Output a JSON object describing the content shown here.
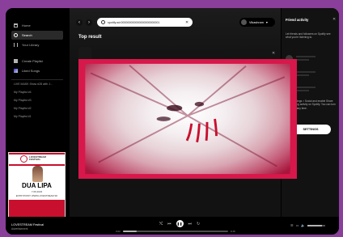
{
  "sidebar": {
    "nav": [
      {
        "label": "Home",
        "icon": "home-icon"
      },
      {
        "label": "Search",
        "icon": "search-icon"
      },
      {
        "label": "Your Library",
        "icon": "library-icon"
      }
    ],
    "create_playlist": "Create Playlist",
    "liked_songs": "Liked Songs",
    "playlists": [
      "LIVE MASK Show #28 with J...",
      "My Playlist #4",
      "My Playlist #3",
      "My Playlist #2",
      "My Playlist #1"
    ],
    "cover": {
      "brand_line1": "LOVESTREAM",
      "brand_line2": "FESTIVAL",
      "artist": "DUA LIPA",
      "date": "7.06.2023",
      "tickets": "ENTRYPOINT: WWW.LOVESTREAM.SK"
    }
  },
  "topbar": {
    "back": "‹",
    "forward": "›",
    "search_value": "spotify:ad:000000000000000000000001",
    "clear": "✕",
    "user_name": "Vikashram",
    "user_caret": "▾"
  },
  "main": {
    "heading": "Top result",
    "close": "✕"
  },
  "activity": {
    "title": "Friend activity",
    "close": "✕",
    "intro": "Let friends and followers on Spotify see what you're listening to.",
    "settings_text": "Go to Settings > Social and enable Share my listening activity on Spotify. You can turn this off at any time.",
    "settings_button": "SETTINGS"
  },
  "player": {
    "title": "LOVESTREAM Festival",
    "artist": "Advertisement",
    "shuffle": "⤭",
    "prev": "⏮",
    "play": "❚❚",
    "next": "⏭",
    "repeat": "↻",
    "elapsed": "0:02",
    "duration": "0:15",
    "progress": 0.13,
    "volume": 0.8,
    "right_icons": [
      "☰",
      "▭",
      "🔈"
    ]
  },
  "colors": {
    "background": "#8a3f9a",
    "accent": "#d8174a"
  }
}
